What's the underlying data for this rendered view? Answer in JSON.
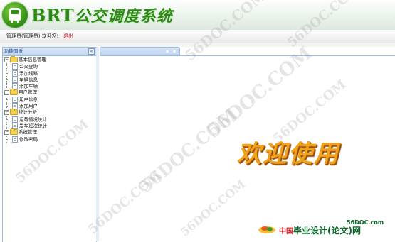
{
  "app": {
    "title_latin": "BRT",
    "title_cn": "公交调度系统",
    "logo_icon": "bus-icon"
  },
  "userbar": {
    "welcome": "管理员(管理员),欢迎您!",
    "logout": "退出"
  },
  "sidebar": {
    "title": "功能面板",
    "collapse_symbol": "«",
    "groups": [
      {
        "label": "基本信息管理",
        "toggle": "−",
        "items": [
          "公交查询",
          "添加线路",
          "车辆信息",
          "添加车辆"
        ]
      },
      {
        "label": "用户管理",
        "toggle": "−",
        "items": [
          "用户信息",
          "添加用户"
        ]
      },
      {
        "label": "统计分析",
        "toggle": "−",
        "items": [
          "运载情况统计",
          "发车班次统计"
        ]
      },
      {
        "label": "系统管理",
        "toggle": "−",
        "items": [
          "修改密码"
        ]
      }
    ]
  },
  "content": {
    "welcome": "欢迎使用",
    "tab_tools": "▪ ▪"
  },
  "watermark": {
    "text": "56DOC.COM"
  },
  "footer": {
    "brand_small_a": "56DOC",
    "brand_small_dot": ".",
    "brand_small_b": "com",
    "brand_cn": "中国",
    "brand_rest": "毕业设计(论文)网"
  },
  "colors": {
    "accent_green": "#2b8a12",
    "panel_border": "#99bbe8",
    "logout_red": "#d01818",
    "welcome_orange": "#f0a21b"
  }
}
